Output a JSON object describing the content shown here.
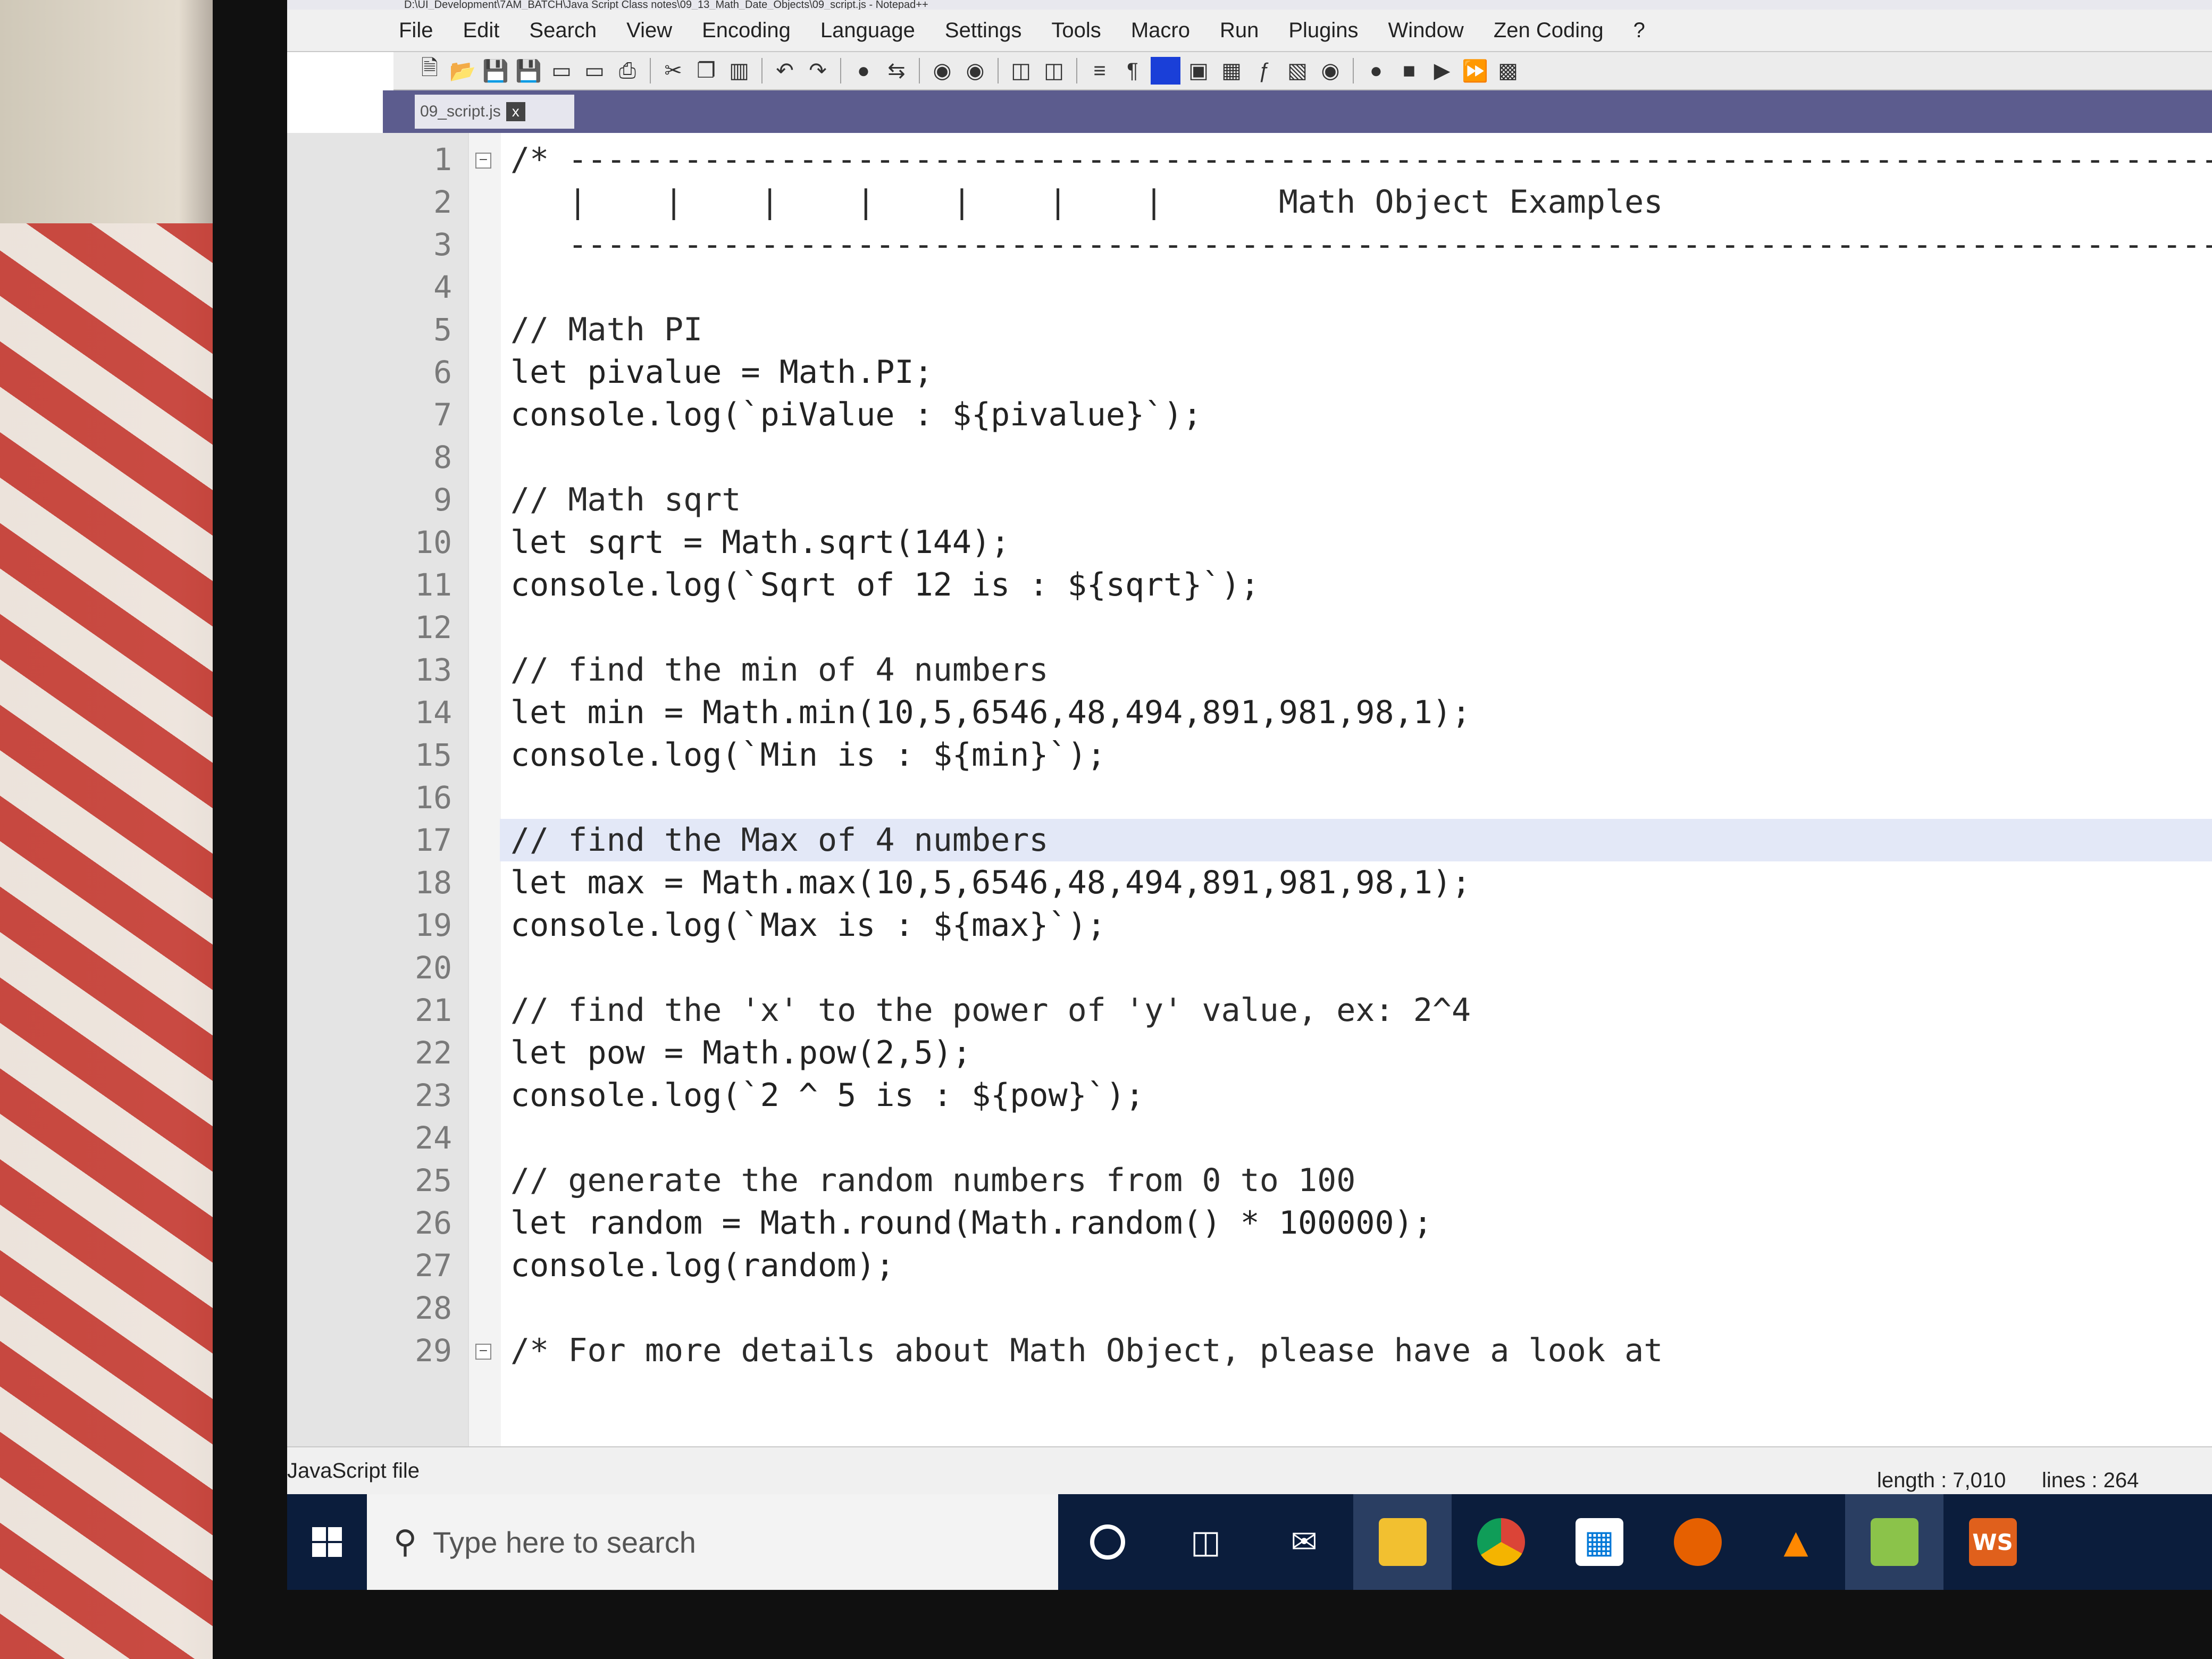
{
  "window": {
    "title": "D:\\UI_Development\\7AM_BATCH\\Java Script Class notes\\09_13_Math_Date_Objects\\09_script.js - Notepad++"
  },
  "menu": [
    "File",
    "Edit",
    "Search",
    "View",
    "Encoding",
    "Language",
    "Settings",
    "Tools",
    "Macro",
    "Run",
    "Plugins",
    "Window",
    "Zen Coding",
    "?"
  ],
  "toolbar": {
    "icons": [
      "new-file-icon",
      "open-icon",
      "save-icon",
      "save-all-icon",
      "close-icon",
      "close-all-icon",
      "print-icon",
      "cut-icon",
      "copy-icon",
      "paste-icon",
      "undo-icon",
      "redo-icon",
      "find-icon",
      "replace-icon",
      "zoom-in-icon",
      "zoom-out-icon",
      "sync-v-icon",
      "sync-h-icon",
      "word-wrap-icon",
      "show-all-chars-icon",
      "indent-guide-icon",
      "lang-icon",
      "doc-map-icon",
      "function-list-icon",
      "folder-workspace-icon",
      "monitor-icon",
      "record-macro-icon",
      "stop-macro-icon",
      "play-macro-icon",
      "run-multiple-icon",
      "save-macro-icon"
    ]
  },
  "tab": {
    "label": "09_script.js",
    "close": "x"
  },
  "editor": {
    "current_line": 17,
    "lines": [
      {
        "n": "1",
        "code": "/* -----------------------------------------------------------------------------------------------"
      },
      {
        "n": "2",
        "code": "   |    |    |    |    |    |    |      Math Object Examples"
      },
      {
        "n": "3",
        "code": "   ----------------------------------------------------------------------------------------------- */"
      },
      {
        "n": "4",
        "code": ""
      },
      {
        "n": "5",
        "code": "// Math PI"
      },
      {
        "n": "6",
        "code": "let pivalue = Math.PI;"
      },
      {
        "n": "7",
        "code": "console.log(`piValue : ${pivalue}`);"
      },
      {
        "n": "8",
        "code": ""
      },
      {
        "n": "9",
        "code": "// Math sqrt"
      },
      {
        "n": "10",
        "code": "let sqrt = Math.sqrt(144);"
      },
      {
        "n": "11",
        "code": "console.log(`Sqrt of 12 is : ${sqrt}`);"
      },
      {
        "n": "12",
        "code": ""
      },
      {
        "n": "13",
        "code": "// find the min of 4 numbers"
      },
      {
        "n": "14",
        "code": "let min = Math.min(10,5,6546,48,494,891,981,98,1);"
      },
      {
        "n": "15",
        "code": "console.log(`Min is : ${min}`);"
      },
      {
        "n": "16",
        "code": ""
      },
      {
        "n": "17",
        "code": "// find the Max of 4 numbers"
      },
      {
        "n": "18",
        "code": "let max = Math.max(10,5,6546,48,494,891,981,98,1);"
      },
      {
        "n": "19",
        "code": "console.log(`Max is : ${max}`);"
      },
      {
        "n": "20",
        "code": ""
      },
      {
        "n": "21",
        "code": "// find the 'x' to the power of 'y' value, ex: 2^4"
      },
      {
        "n": "22",
        "code": "let pow = Math.pow(2,5);"
      },
      {
        "n": "23",
        "code": "console.log(`2 ^ 5 is : ${pow}`);"
      },
      {
        "n": "24",
        "code": ""
      },
      {
        "n": "25",
        "code": "// generate the random numbers from 0 to 100"
      },
      {
        "n": "26",
        "code": "let random = Math.round(Math.random() * 100000);"
      },
      {
        "n": "27",
        "code": "console.log(random);"
      },
      {
        "n": "28",
        "code": ""
      },
      {
        "n": "29",
        "code": "/* For more details about Math Object, please have a look at"
      }
    ]
  },
  "status": {
    "file_type": "JavaScript file",
    "length": "length : 7,010",
    "lines": "lines : 264"
  },
  "taskbar": {
    "search_placeholder": "Type here to search",
    "apps": [
      "cortana-icon",
      "task-view-icon",
      "mail-icon",
      "file-explorer-icon",
      "chrome-icon",
      "store-icon",
      "firefox-icon",
      "vlc-icon",
      "notepadpp-icon",
      "webstorm-icon"
    ]
  }
}
